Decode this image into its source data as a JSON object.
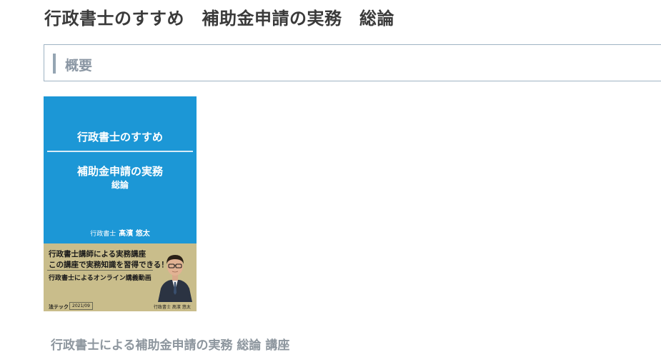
{
  "page": {
    "title": "行政書士のすすめ　補助金申請の実務　総論"
  },
  "section": {
    "heading": "概要"
  },
  "cover": {
    "series": "行政書士のすすめ",
    "title": "補助金申請の実務",
    "subtitle": "総論",
    "author_role": "行政書士",
    "author_name": "髙濱 悠太",
    "promo_line1": "行政書士講師による実務講座",
    "promo_line2": "この講座で実務知識を習得できる！",
    "promo_line3": "行政書士によるオンライン講義動画",
    "publisher": "法テック",
    "pub_date": "2021/09",
    "instructor_caption": "行政書士 髙濱 悠太",
    "colors": {
      "top": "#1c97d6",
      "bottom": "#c9bd8b"
    }
  },
  "course": {
    "link_label": "行政書士による補助金申請の実務 総論 講座"
  }
}
